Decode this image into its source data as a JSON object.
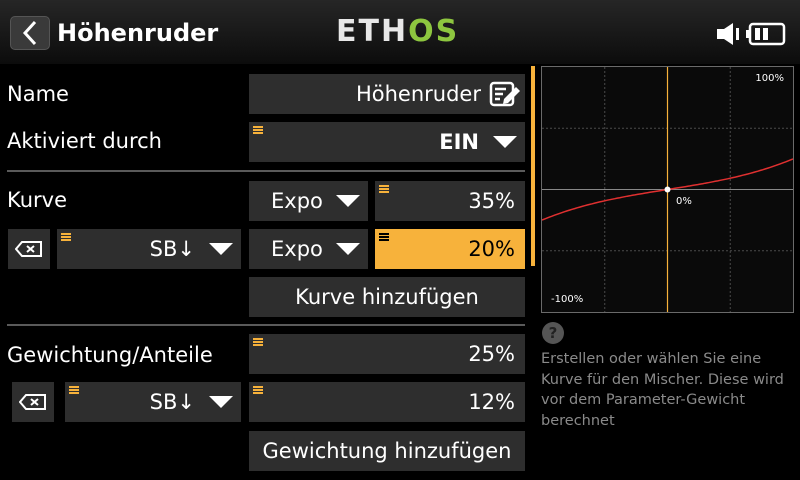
{
  "header": {
    "title": "Höhenruder",
    "logo_a": "ETH",
    "logo_b": "OS",
    "back_icon": "chevron-left-icon",
    "speaker_icon": "speaker-icon",
    "battery_icon": "battery-icon"
  },
  "name_row": {
    "label": "Name",
    "value": "Höhenruder",
    "icon": "edit-icon"
  },
  "active_row": {
    "label": "Aktiviert durch",
    "value": "EIN"
  },
  "curve_section": {
    "label": "Kurve",
    "type": "Expo",
    "value": "35%",
    "sub": {
      "source": "SB↓",
      "type": "Expo",
      "value": "20%"
    },
    "add_button": "Kurve hinzufügen"
  },
  "weight_section": {
    "label": "Gewichtung/Anteile",
    "value": "25%",
    "sub": {
      "source": "SB↓",
      "value": "12%"
    },
    "add_button": "Gewichtung hinzufügen"
  },
  "graph": {
    "top_label": "100%",
    "center_label": "0%",
    "bottom_label": "-100%",
    "line_color": "#e03030",
    "cursor_color": "#f7b23b"
  },
  "help": {
    "text": "Erstellen oder wählen Sie eine Kurve für den Mischer. Diese wird vor dem Parameter-Gewicht berechnet"
  },
  "colors": {
    "accent": "#f7b23b",
    "field_bg": "#2e2e2e",
    "logo_green": "#8dc63f"
  }
}
